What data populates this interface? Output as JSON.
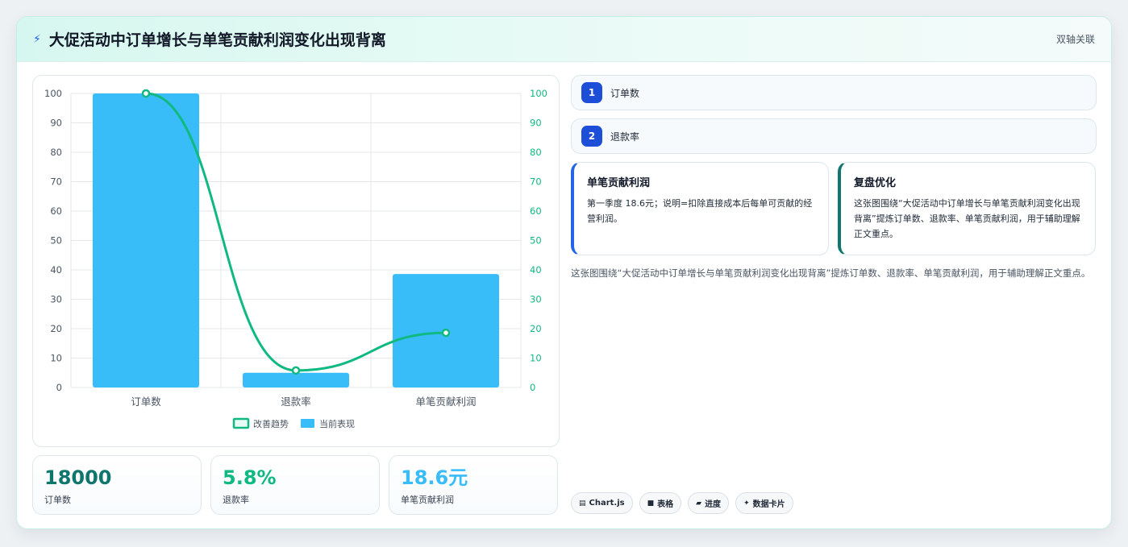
{
  "header": {
    "title": "大促活动中订单增长与单笔贡献利润变化出现背离",
    "tag": "双轴关联",
    "icon": "bolt-icon"
  },
  "chart_data": {
    "type": "bar",
    "categories": [
      "订单数",
      "退款率",
      "单笔贡献利润"
    ],
    "series": [
      {
        "name": "当前表现",
        "type": "bar",
        "color": "#38bdf8",
        "values": [
          100,
          5,
          38.6
        ]
      },
      {
        "name": "改善趋势",
        "type": "line",
        "color": "#10b981",
        "values": [
          100,
          5.8,
          18.6
        ]
      }
    ],
    "ylim": [
      0,
      100
    ],
    "yticks": [
      0,
      10,
      20,
      30,
      40,
      50,
      60,
      70,
      80,
      90,
      100
    ],
    "y2ticks": [
      0,
      10,
      20,
      30,
      40,
      50,
      60,
      70,
      80,
      90,
      100
    ],
    "grid": true,
    "legend": "bottom",
    "legend_items": [
      "改善趋势",
      "当前表现"
    ]
  },
  "stats": [
    {
      "value": "18000",
      "label": "订单数",
      "color": "#0f766e"
    },
    {
      "value": "5.8%",
      "label": "退款率",
      "color": "#10b981"
    },
    {
      "value": "18.6元",
      "label": "单笔贡献利润",
      "color": "#38bdf8"
    }
  ],
  "list": [
    {
      "num": "1",
      "label": "订单数"
    },
    {
      "num": "2",
      "label": "退款率"
    }
  ],
  "info_cards": [
    {
      "title": "单笔贡献利润",
      "body": "第一季度 18.6元；说明=扣除直接成本后每单可贡献的经营利润。"
    },
    {
      "title": "复盘优化",
      "body": "这张图围绕“大促活动中订单增长与单笔贡献利润变化出现背离”提炼订单数、退款率、单笔贡献利润，用于辅助理解正文重点。"
    }
  ],
  "summary": "这张图围绕“大促活动中订单增长与单笔贡献利润变化出现背离”提炼订单数、退款率、单笔贡献利润，用于辅助理解正文重点。",
  "tags": [
    {
      "icon": "chart-icon",
      "glyph": "▤",
      "label": "Chart.js"
    },
    {
      "icon": "table-icon",
      "glyph": "■",
      "label": "表格"
    },
    {
      "icon": "progress-icon",
      "glyph": "▰",
      "label": "进度"
    },
    {
      "icon": "sparkle-icon",
      "glyph": "✦",
      "label": "数据卡片"
    }
  ]
}
